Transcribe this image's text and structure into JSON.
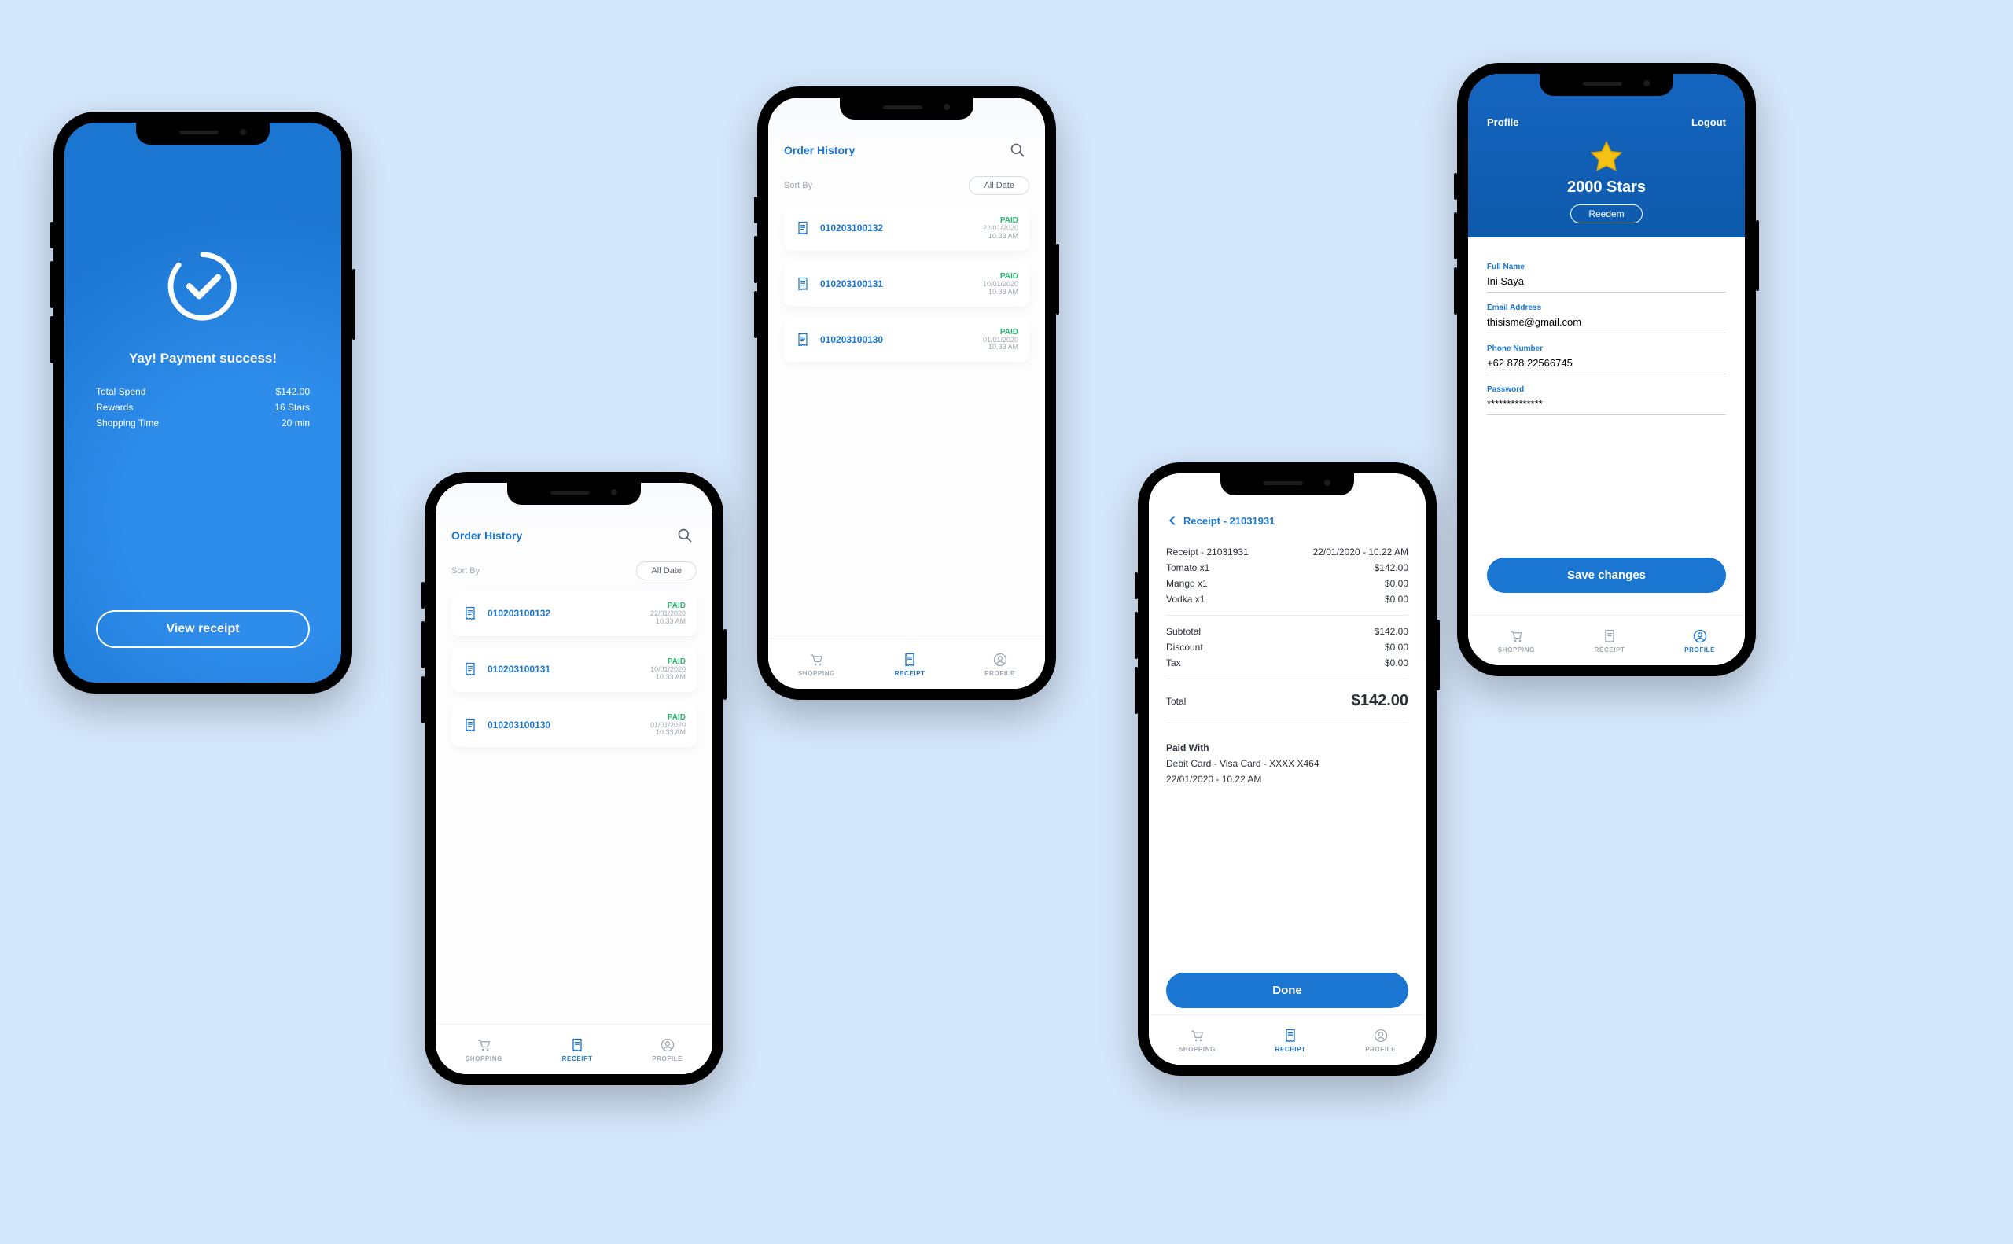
{
  "success": {
    "headline": "Yay! Payment success!",
    "rows": {
      "total_spend_label": "Total Spend",
      "total_spend_value": "$142.00",
      "rewards_label": "Rewards",
      "rewards_value": "16 Stars",
      "time_label": "Shopping Time",
      "time_value": "20 min"
    },
    "cta": "View receipt"
  },
  "orderHistory": {
    "title": "Order History",
    "sort_label": "Sort By",
    "filter_chip": "All Date",
    "orders": [
      {
        "id": "010203100132",
        "status": "PAID",
        "date": "22/01/2020",
        "time": "10.33 AM"
      },
      {
        "id": "010203100131",
        "status": "PAID",
        "date": "10/01/2020",
        "time": "10.33 AM"
      },
      {
        "id": "010203100130",
        "status": "PAID",
        "date": "01/01/2020",
        "time": "10.33 AM"
      }
    ]
  },
  "receipt": {
    "back": "Receipt - 21031931",
    "header_label": "Receipt - 21031931",
    "header_time": "22/01/2020 - 10.22 AM",
    "items": [
      {
        "name": "Tomato x1",
        "price": "$142.00"
      },
      {
        "name": "Mango x1",
        "price": "$0.00"
      },
      {
        "name": "Vodka x1",
        "price": "$0.00"
      }
    ],
    "subtotal_label": "Subtotal",
    "subtotal_value": "$142.00",
    "discount_label": "Discount",
    "discount_value": "$0.00",
    "tax_label": "Tax",
    "tax_value": "$0.00",
    "total_label": "Total",
    "total_value": "$142.00",
    "paid_with_label": "Paid With",
    "paid_with_line1": "Debit Card - Visa Card - XXXX X464",
    "paid_with_line2": "22/01/2020 - 10.22 AM",
    "done": "Done"
  },
  "profile": {
    "title": "Profile",
    "logout": "Logout",
    "stars": "2000 Stars",
    "redeem": "Reedem",
    "labels": {
      "name": "Full Name",
      "email": "Email Address",
      "phone": "Phone Number",
      "password": "Password"
    },
    "values": {
      "name": "Ini Saya",
      "email": "thisisme@gmail.com",
      "phone": "+62 878 22566745",
      "password": "**************"
    },
    "save": "Save changes"
  },
  "nav": {
    "shopping": "SHOPPING",
    "receipt": "RECEIPT",
    "profile": "PROFILE"
  }
}
